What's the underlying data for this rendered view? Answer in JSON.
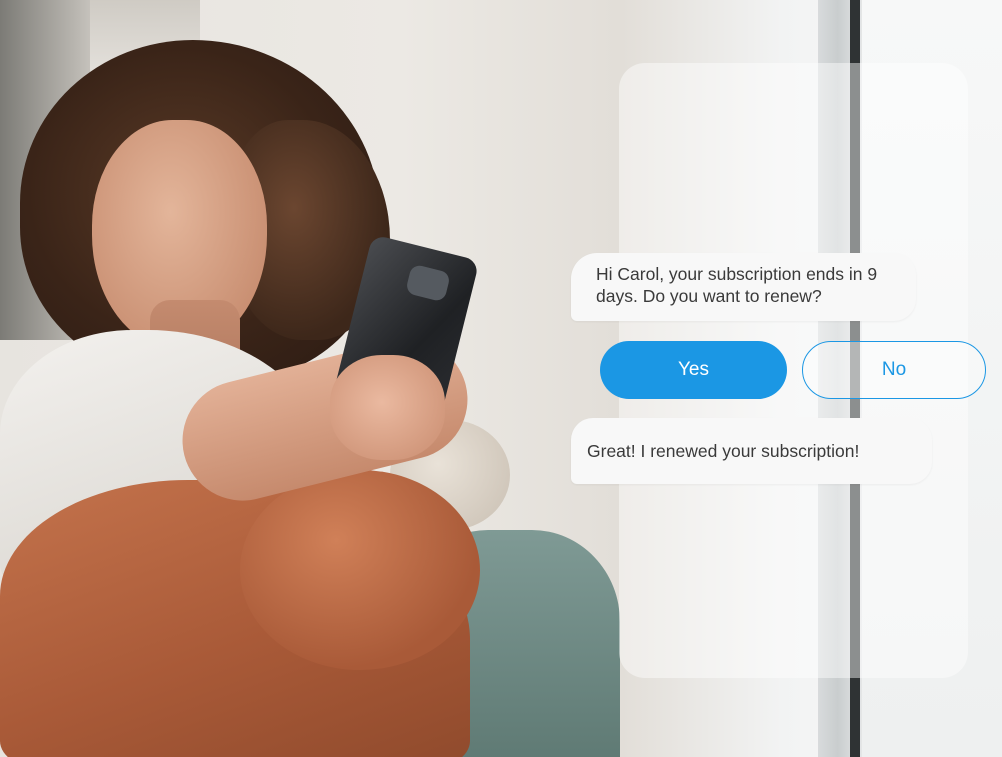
{
  "chat": {
    "messages": [
      {
        "sender": "bot",
        "text": "Hi Carol, your subscription ends in 9 days. Do you want to renew?"
      },
      {
        "sender": "bot",
        "text": "Great! I renewed your subscription!"
      }
    ],
    "buttons": {
      "yes_label": "Yes",
      "no_label": "No"
    }
  },
  "colors": {
    "accent": "#1b97e4",
    "bubble": "#f8f8f8",
    "text": "#3a3a3a"
  }
}
